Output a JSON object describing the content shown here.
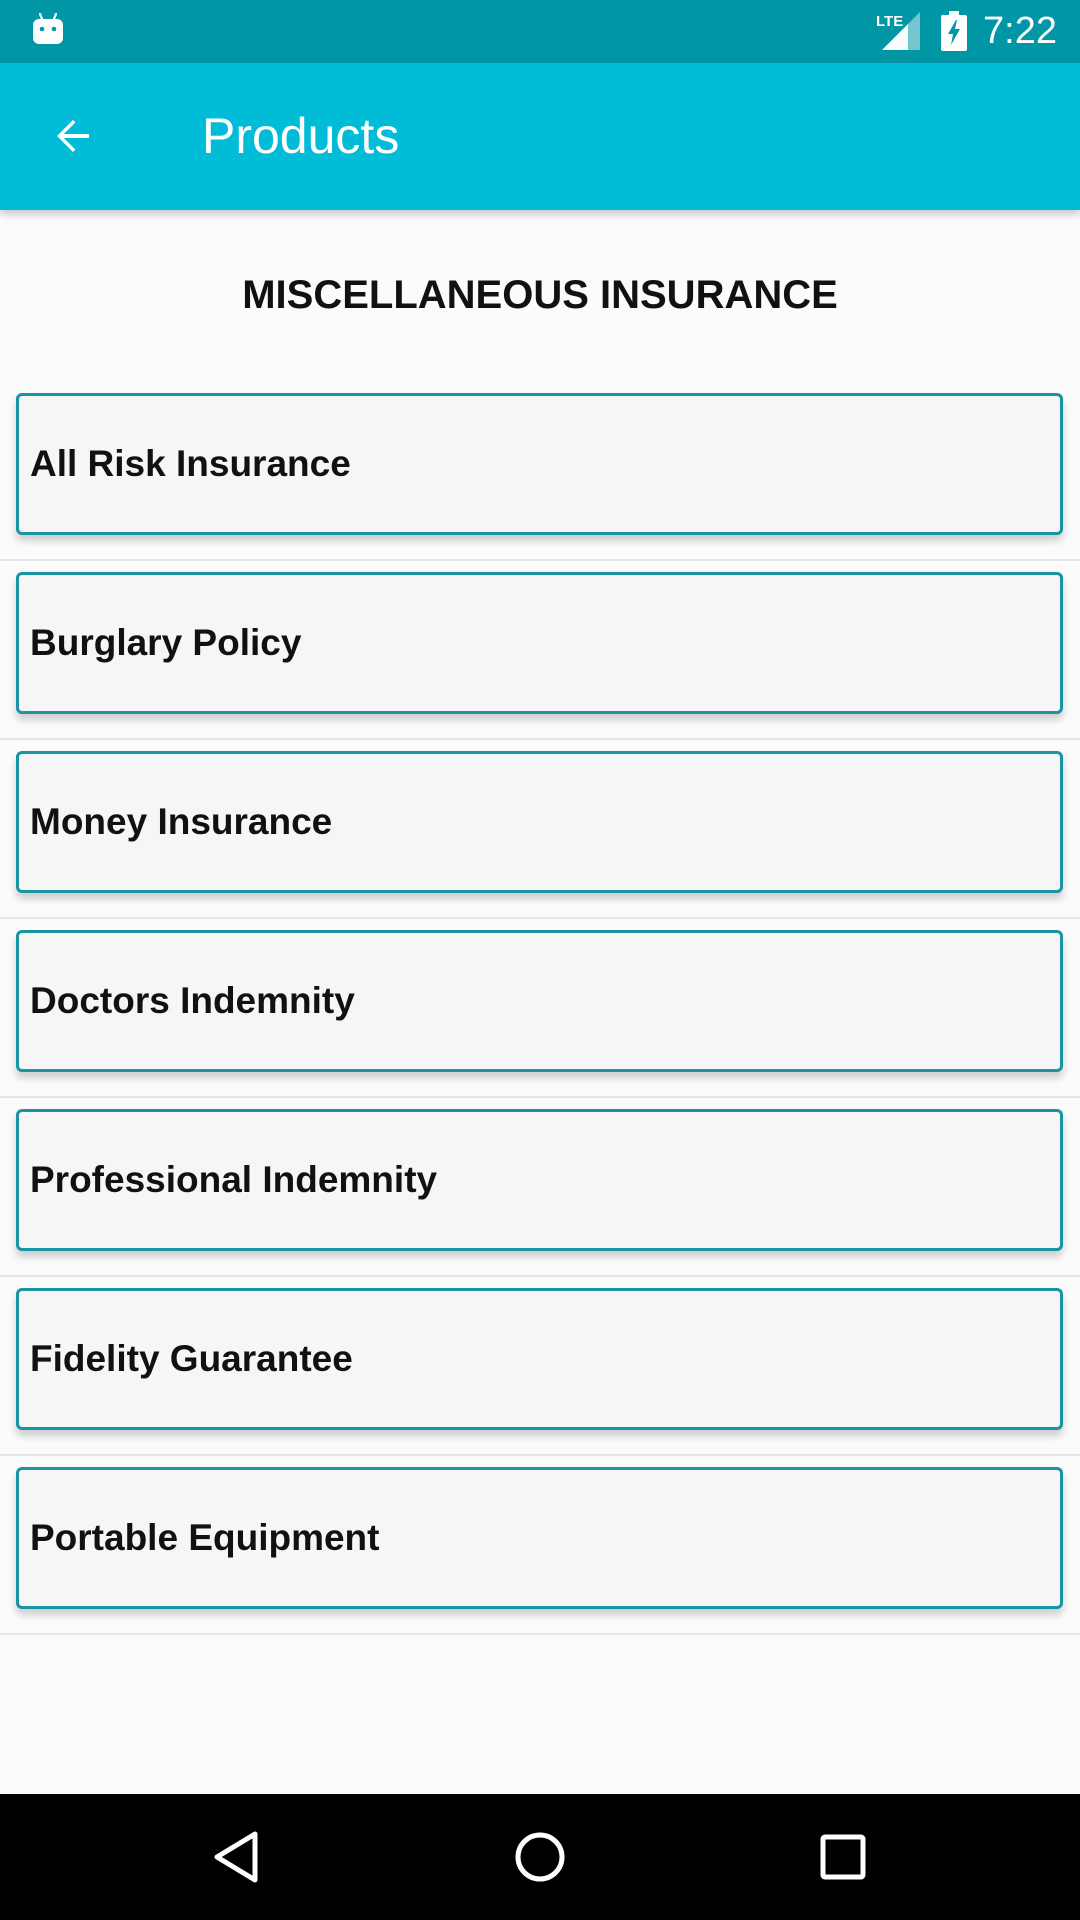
{
  "status_bar": {
    "time": "7:22",
    "network_label": "LTE",
    "icons": [
      "android-icon",
      "lte-signal-icon",
      "battery-charging-icon"
    ]
  },
  "app_bar": {
    "title": "Products",
    "back_icon": "arrow-back-icon"
  },
  "section": {
    "title": "MISCELLANEOUS INSURANCE"
  },
  "products": [
    {
      "label": "All Risk Insurance"
    },
    {
      "label": "Burglary Policy"
    },
    {
      "label": "Money Insurance"
    },
    {
      "label": "Doctors Indemnity"
    },
    {
      "label": "Professional Indemnity"
    },
    {
      "label": "Fidelity Guarantee"
    },
    {
      "label": "Portable Equipment"
    }
  ],
  "nav_bar": {
    "icons": [
      "back-triangle-icon",
      "home-circle-icon",
      "recents-square-icon"
    ]
  },
  "colors": {
    "status_bar": "#0096a6",
    "app_bar": "#00bcd6",
    "card_border": "#1a93a2",
    "card_background": "#f6f6f6"
  }
}
